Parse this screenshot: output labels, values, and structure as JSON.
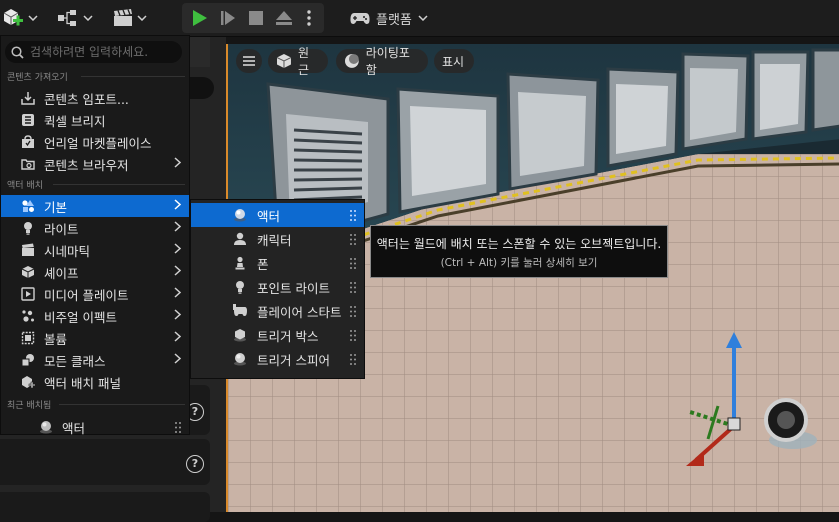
{
  "toolbar": {
    "platform_label": "플랫폼"
  },
  "viewport": {
    "menu_pill_icon": "hamburger-icon",
    "perspective_label": "원근",
    "lighting_label": "라이팅포함",
    "show_label": "표시"
  },
  "menu": {
    "search_placeholder": "검색하려면 입력하세요.",
    "section_content": "콘텐츠 가져오기",
    "content_items": [
      {
        "label": "콘텐츠 임포트...",
        "icon": "import-icon"
      },
      {
        "label": "퀵셀 브리지",
        "icon": "quixel-bridge-icon"
      },
      {
        "label": "언리얼 마켓플레이스",
        "icon": "marketplace-icon"
      },
      {
        "label": "콘텐츠 브라우저",
        "icon": "content-browser-icon"
      }
    ],
    "section_actor": "액터 배치",
    "actor_items": [
      {
        "label": "기본",
        "icon": "basic-shapes-icon",
        "selected": true
      },
      {
        "label": "라이트",
        "icon": "light-bulb-icon"
      },
      {
        "label": "시네마틱",
        "icon": "cinematic-icon"
      },
      {
        "label": "셰이프",
        "icon": "cube-icon"
      },
      {
        "label": "미디어 플레이트",
        "icon": "media-plate-icon"
      },
      {
        "label": "비주얼 이펙트",
        "icon": "visual-effects-icon"
      },
      {
        "label": "볼륨",
        "icon": "volume-icon"
      },
      {
        "label": "모든 클래스",
        "icon": "all-classes-icon"
      },
      {
        "label": "액터 배치 패널",
        "icon": "place-actors-panel-icon"
      }
    ],
    "section_recent": "최근 배치됨",
    "recent_items": [
      {
        "label": "액터",
        "icon": "actor-sphere-icon"
      }
    ]
  },
  "submenu": {
    "items": [
      {
        "label": "액터",
        "icon": "actor-sphere-icon",
        "selected": true
      },
      {
        "label": "캐릭터",
        "icon": "character-icon"
      },
      {
        "label": "폰",
        "icon": "pawn-icon"
      },
      {
        "label": "포인트 라이트",
        "icon": "point-light-icon"
      },
      {
        "label": "플레이어 스타트",
        "icon": "player-start-icon"
      },
      {
        "label": "트리거 박스",
        "icon": "trigger-box-icon"
      },
      {
        "label": "트리거 스피어",
        "icon": "trigger-sphere-icon"
      }
    ]
  },
  "tooltip": {
    "text": "액터는 월드에 배치 또는 스폰할 수 있는 오브젝트입니다.",
    "hint": "(Ctrl + Alt) 키를 눌러 상세히 보기"
  },
  "colors": {
    "accent_blue": "#0d6ad0",
    "play_green": "#3fbf3f",
    "viewport_border": "#d98a2b"
  }
}
